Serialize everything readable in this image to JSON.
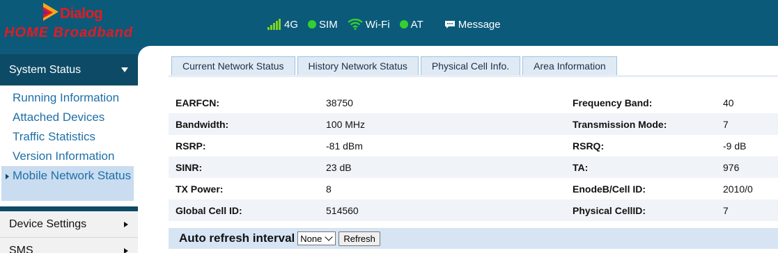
{
  "brand": {
    "name": "Dialog",
    "product": "HOME Broadband"
  },
  "status": {
    "signal": {
      "label": "4G",
      "icon": "signal-bars-icon"
    },
    "sim": {
      "label": "SIM",
      "icon": "status-dot-icon"
    },
    "wifi": {
      "label": "Wi-Fi",
      "icon": "wifi-icon"
    },
    "at": {
      "label": "AT",
      "icon": "status-dot-icon"
    },
    "message": {
      "label": "Message",
      "icon": "message-icon"
    }
  },
  "sidebar": {
    "header": "System Status",
    "items": [
      {
        "label": "Running Information"
      },
      {
        "label": "Attached Devices"
      },
      {
        "label": "Traffic Statistics"
      },
      {
        "label": "Version Information"
      },
      {
        "label": "Mobile Network Status"
      }
    ],
    "sections": [
      {
        "label": "Device Settings"
      },
      {
        "label": "SMS"
      }
    ]
  },
  "tabs": [
    {
      "label": "Current Network Status"
    },
    {
      "label": "History Network Status"
    },
    {
      "label": "Physical Cell Info."
    },
    {
      "label": "Area Information"
    }
  ],
  "network": {
    "rows": [
      {
        "k1": "EARFCN:",
        "v1": "38750",
        "k2": "Frequency Band:",
        "v2": "40"
      },
      {
        "k1": "Bandwidth:",
        "v1": "100 MHz",
        "k2": "Transmission Mode:",
        "v2": "7"
      },
      {
        "k1": "RSRP:",
        "v1": "-81 dBm",
        "k2": "RSRQ:",
        "v2": "-9 dB"
      },
      {
        "k1": "SINR:",
        "v1": "23 dB",
        "k2": "TA:",
        "v2": "976"
      },
      {
        "k1": "TX Power:",
        "v1": "8",
        "k2": "EnodeB/Cell ID:",
        "v2": "2010/0"
      },
      {
        "k1": "Global Cell ID:",
        "v1": "514560",
        "k2": "Physical CellID:",
        "v2": "7"
      }
    ]
  },
  "refresh": {
    "label": "Auto refresh interval",
    "selected": "None",
    "button": "Refresh"
  },
  "colors": {
    "header": "#0b5a7a",
    "accent": "#0d4a66",
    "brand_red": "#e31b23",
    "link": "#1f6fa8",
    "status_green": "#34d12e"
  }
}
